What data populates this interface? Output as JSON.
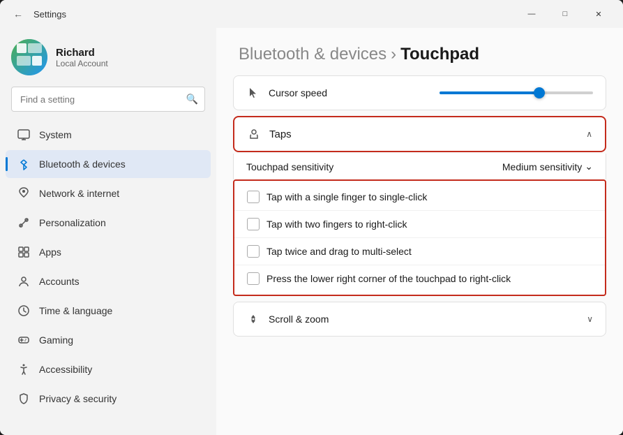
{
  "window": {
    "title": "Settings",
    "controls": {
      "minimize": "—",
      "maximize": "□",
      "close": "✕"
    }
  },
  "user": {
    "name": "Richard",
    "account_type": "Local Account"
  },
  "search": {
    "placeholder": "Find a setting"
  },
  "nav": {
    "items": [
      {
        "id": "system",
        "label": "System",
        "icon": "system"
      },
      {
        "id": "bluetooth",
        "label": "Bluetooth & devices",
        "icon": "bluetooth",
        "active": true
      },
      {
        "id": "network",
        "label": "Network & internet",
        "icon": "network"
      },
      {
        "id": "personalization",
        "label": "Personalization",
        "icon": "personalization"
      },
      {
        "id": "apps",
        "label": "Apps",
        "icon": "apps"
      },
      {
        "id": "accounts",
        "label": "Accounts",
        "icon": "accounts"
      },
      {
        "id": "time",
        "label": "Time & language",
        "icon": "time"
      },
      {
        "id": "gaming",
        "label": "Gaming",
        "icon": "gaming"
      },
      {
        "id": "accessibility",
        "label": "Accessibility",
        "icon": "accessibility"
      },
      {
        "id": "privacy",
        "label": "Privacy & security",
        "icon": "privacy"
      }
    ]
  },
  "breadcrumb": {
    "parent": "Bluetooth & devices",
    "current": "Touchpad",
    "separator": "›"
  },
  "settings": {
    "cursor_speed": {
      "label": "Cursor speed",
      "value": 65
    },
    "taps_section": {
      "title": "Taps",
      "expanded": true
    },
    "touchpad_sensitivity": {
      "label": "Touchpad sensitivity",
      "value": "Medium sensitivity"
    },
    "checkboxes": [
      {
        "id": "single-tap",
        "label": "Tap with a single finger to single-click",
        "checked": false
      },
      {
        "id": "two-finger",
        "label": "Tap with two fingers to right-click",
        "checked": false
      },
      {
        "id": "double-tap",
        "label": "Tap twice and drag to multi-select",
        "checked": false
      },
      {
        "id": "corner-tap",
        "label": "Press the lower right corner of the touchpad to right-click",
        "checked": false
      }
    ],
    "scroll_zoom": {
      "label": "Scroll & zoom"
    }
  }
}
